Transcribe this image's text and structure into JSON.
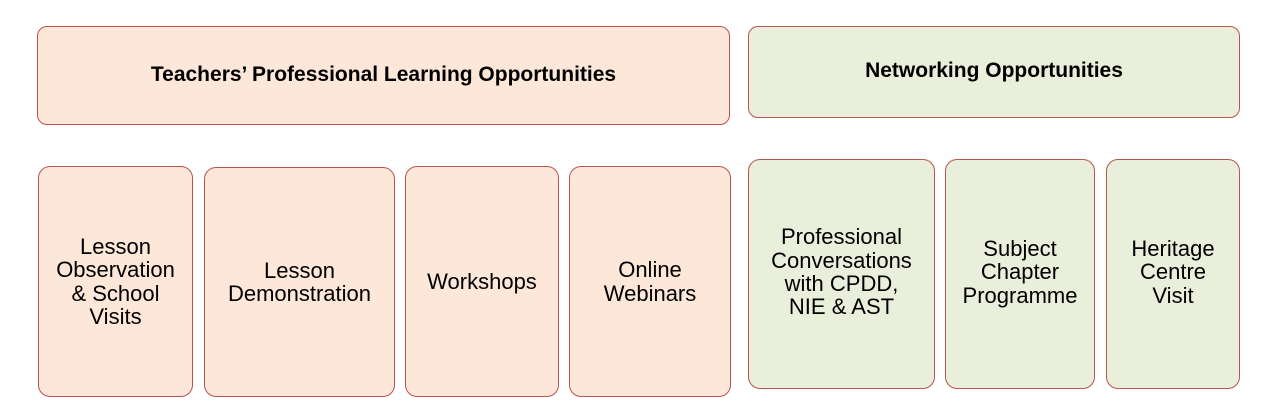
{
  "colors": {
    "pink_fill": "#fce7d9",
    "green_fill": "#eaefdc",
    "border": "#b85450"
  },
  "professional_learning": {
    "header": "Teachers’ Professional Learning Opportunities",
    "items": [
      "Lesson\nObservation\n& School\nVisits",
      "Lesson\nDemonstration",
      "Workshops",
      "Online\nWebinars"
    ]
  },
  "networking": {
    "header": "Networking Opportunities",
    "items": [
      "Professional\nConversations\nwith CPDD,\nNIE & AST",
      "Subject\nChapter\nProgramme",
      "Heritage\nCentre\nVisit"
    ]
  }
}
